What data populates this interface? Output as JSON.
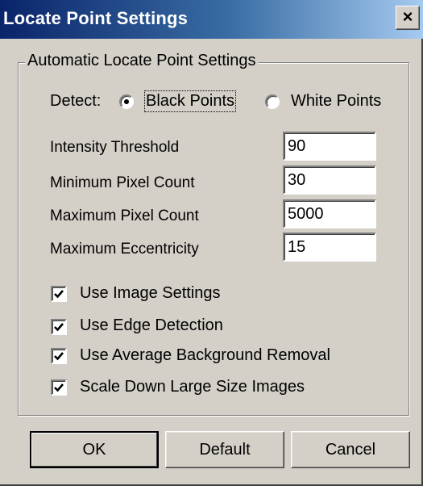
{
  "window": {
    "title": "Locate Point Settings",
    "close_glyph": "×",
    "close_icon": "close-icon"
  },
  "group": {
    "legend": "Automatic Locate Point Settings",
    "detect": {
      "label": "Detect:",
      "options": [
        "Black Points",
        "White Points"
      ],
      "selected": "Black Points"
    },
    "fields": [
      {
        "label": "Intensity Threshold",
        "value": "90"
      },
      {
        "label": "Minimum Pixel Count",
        "value": "30"
      },
      {
        "label": "Maximum Pixel Count",
        "value": "5000"
      },
      {
        "label": "Maximum Eccentricity",
        "value": "15"
      }
    ],
    "checkboxes": [
      {
        "label": "Use Image Settings",
        "checked": true
      },
      {
        "label": "Use Edge Detection",
        "checked": true
      },
      {
        "label": "Use Average Background Removal",
        "checked": true
      },
      {
        "label": "Scale Down Large Size Images",
        "checked": true
      }
    ]
  },
  "buttons": {
    "ok": "OK",
    "default": "Default",
    "cancel": "Cancel"
  },
  "colors": {
    "title_start": "#0a246a",
    "title_end": "#a6caf0",
    "face": "#d4d0c8"
  }
}
